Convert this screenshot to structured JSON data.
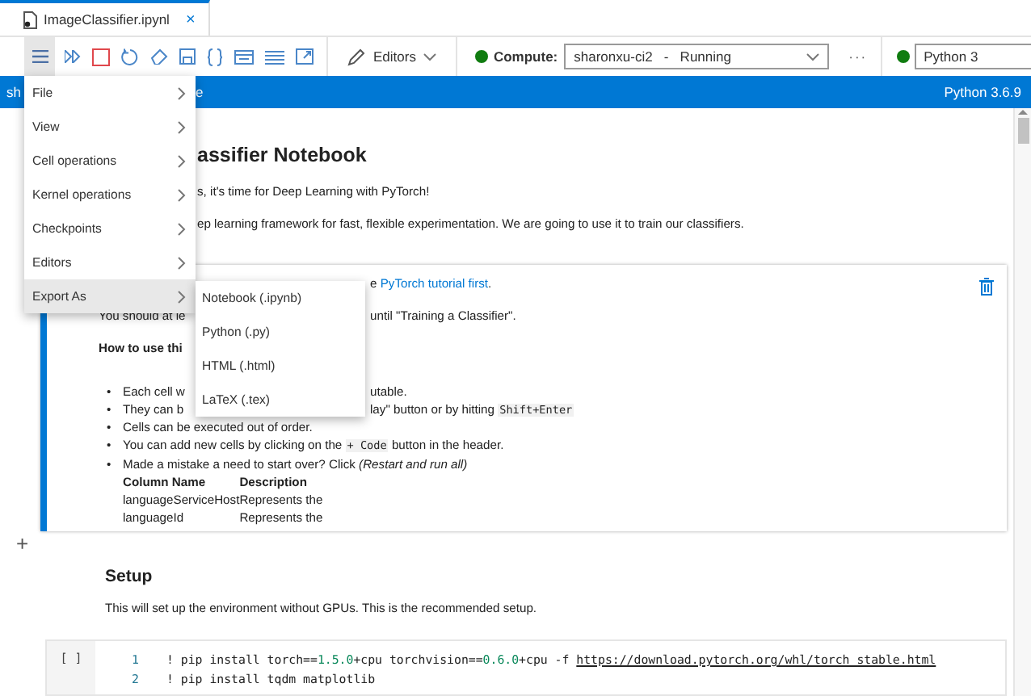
{
  "tab": {
    "title": "ImageClassifier.ipynl",
    "close": "×",
    "selected": true
  },
  "toolbar": {
    "menu_open": true,
    "editors": "Editors",
    "compute": {
      "label": "Compute:",
      "target": "sharonxu-ci2",
      "separator": "-",
      "status": "Running"
    },
    "more": "···",
    "kernel": "Python 3"
  },
  "header_bar": {
    "left": "sh",
    "after_menu": "e",
    "right": "Python 3.6.9"
  },
  "menu": {
    "items": [
      {
        "label": "File",
        "selected": false
      },
      {
        "label": "View",
        "selected": false
      },
      {
        "label": "Cell operations",
        "selected": false
      },
      {
        "label": "Kernel operations",
        "selected": false
      },
      {
        "label": "Checkpoints",
        "selected": false
      },
      {
        "label": "Editors",
        "selected": false
      },
      {
        "label": "Export As",
        "selected": true
      }
    ],
    "submenu": [
      "Notebook (.ipynb)",
      "Python (.py)",
      "HTML (.html)",
      "LaTeX (.tex)"
    ]
  },
  "notebook": {
    "title": "assifier Notebook",
    "intro": [
      "s, it's time for Deep Learning with PyTorch!",
      "ep learning framework for fast, flexible experimentation. We are going to use it to train our classifiers."
    ],
    "markdown_cell": {
      "lines": [
        {
          "kind": "tail",
          "segments": [
            [
              {
                "kind": "text",
                "text": "e "
              },
              {
                "kind": "link",
                "text": "PyTorch tutorial first"
              },
              {
                "kind": "text",
                "text": "."
              }
            ]
          ]
        },
        {
          "kind": "split",
          "segments": [
            [
              {
                "kind": "text",
                "text": "You should at le"
              }
            ],
            [
              {
                "kind": "text",
                "text": "until \"Training a Classifier\"."
              }
            ]
          ]
        },
        {
          "kind": "bold",
          "segments": [
            [
              {
                "kind": "text",
                "text": "How to use thi"
              }
            ]
          ]
        }
      ],
      "bullets": [
        {
          "kind": "split",
          "marker": "•",
          "segments": [
            [
              {
                "kind": "text",
                "text": "Each cell w"
              }
            ],
            [
              {
                "kind": "text",
                "text": "utable."
              }
            ]
          ]
        },
        {
          "kind": "split",
          "marker": "•",
          "segments": [
            [
              {
                "kind": "text",
                "text": "They can b"
              }
            ],
            [
              {
                "kind": "text",
                "text": "lay\" button or by hitting "
              },
              {
                "kind": "code",
                "text": "Shift+Enter"
              }
            ]
          ]
        },
        {
          "kind": "text",
          "marker": "•",
          "segments": [
            [
              {
                "kind": "text",
                "text": "Cells can be executed out of order."
              }
            ]
          ]
        },
        {
          "kind": "text",
          "marker": "•",
          "segments": [
            [
              {
                "kind": "text",
                "text": "You can add new cells by clicking on the "
              },
              {
                "kind": "code",
                "text": "+ Code"
              },
              {
                "kind": "text",
                "text": " button in the header."
              }
            ]
          ]
        },
        {
          "kind": "text",
          "marker": "•",
          "segments": [
            [
              {
                "kind": "rich",
                "text": "Made a mistake a need to start over? Click *(Restart and run all)*"
              }
            ]
          ]
        }
      ],
      "table": {
        "columns": [
          "Column Name",
          "Description"
        ],
        "rows": [
          [
            "languageServiceHost",
            "Represents the"
          ],
          [
            "languageId",
            "Represents the"
          ]
        ]
      }
    },
    "add_cell": "+",
    "section_title": "Setup",
    "section_text": "This will set up the environment without GPUs. This is the recommended setup.",
    "code_cell": {
      "prompt": "[ ]",
      "lines": [
        {
          "number": "1",
          "tokens": [
            {
              "kind": "plain",
              "text": "! pip install torch=="
            },
            {
              "kind": "number",
              "text": "1.5.0"
            },
            {
              "kind": "plain",
              "text": "+cpu torchvision=="
            },
            {
              "kind": "number",
              "text": "0.6.0"
            },
            {
              "kind": "plain",
              "text": "+cpu -f "
            },
            {
              "kind": "url",
              "text": "https://download.pytorch.org/whl/torch_stable.html"
            }
          ]
        },
        {
          "number": "2",
          "tokens": [
            {
              "kind": "plain",
              "text": "! pip install tqdm matplotlib"
            }
          ]
        }
      ]
    }
  }
}
